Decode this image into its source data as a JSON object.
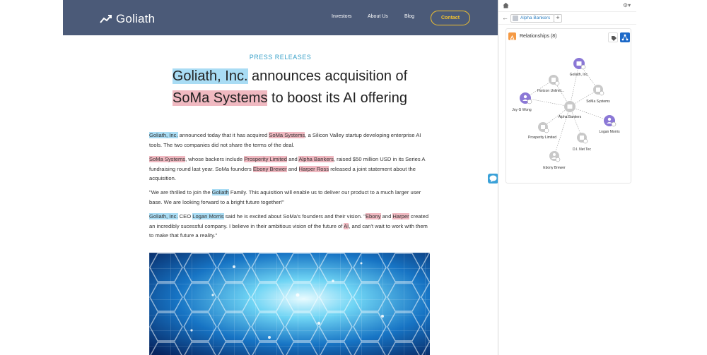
{
  "site": {
    "logo_text": "Goliath",
    "nav": [
      "Investors",
      "About Us",
      "Blog"
    ],
    "contact_label": "Contact"
  },
  "article": {
    "kicker": "PRESS RELEASES",
    "headline": {
      "part1": "Goliath, Inc.",
      "part2": " announces acquisition of",
      "part3": "SoMa Systems",
      "part4": " to boost its AI offering"
    },
    "p1": {
      "e1": "Goliath, Inc.",
      "t1": " announced today that it has acquired ",
      "e2": "SoMa Systems",
      "t2": ", a Silicon Valley startup developing enterprise AI tools. The two companies did not share the terms of the deal."
    },
    "p2": {
      "e1": "SoMa Systems",
      "t1": ", whose backers include ",
      "e2": "Prosperity Limited",
      "t2": " and ",
      "e3": "Alpha Bankers",
      "t3": ", raised $50 million USD in its Series A fundraising round last year. SoMa founders ",
      "e4": "Ebony Brewer",
      "t4": " and ",
      "e5": "Harper Ross",
      "t5": " released a joint statement about the acquisition."
    },
    "p3": {
      "t1": "\"We are thrilled to join the ",
      "e1": "Goliath",
      "t2": " Family. This aquisition will enable us to deliver our product to a much larger user base. We are looking forward to a bright future together!\""
    },
    "p4": {
      "e1": "Goliath, Inc.",
      "t1": " CEO ",
      "e2": "Logan Morris",
      "t2": " said he is excited about SoMa's founders and their vision. \"",
      "e3": "Ebony",
      "t3": " and ",
      "e4": "Harper",
      "t4": " created an incredibly sucessful company. I believe in their ambitious vision of the future of ",
      "e5": "AI",
      "t5": ", and can't wait to work with them to make that future a reality.\""
    }
  },
  "sidebar": {
    "tab_label": "Alpha Bankers",
    "add_tab": "+",
    "relationships_title": "Relationships (8)",
    "nodes": {
      "goliath": "Goliath, Inc.",
      "horizon": "Horizon Unlimit...",
      "soma": "SoMa Systems",
      "joy": "Joy G Wong",
      "alpha": "Alpha Bankers",
      "logan": "Logan Morris",
      "prosperity": "Prosperity Limited",
      "dinet": "D.I. Net Tec",
      "ebony": "Ebony Brewer"
    }
  },
  "colors": {
    "header_bg": "#4b5a78",
    "contact_accent": "#f2c230",
    "blue_highlight": "#a9dcf4",
    "pink_highlight": "#f0b9c1",
    "kicker": "#3aa1c9",
    "node_purple": "#8b78d6",
    "node_gray": "#c9c9c9"
  }
}
